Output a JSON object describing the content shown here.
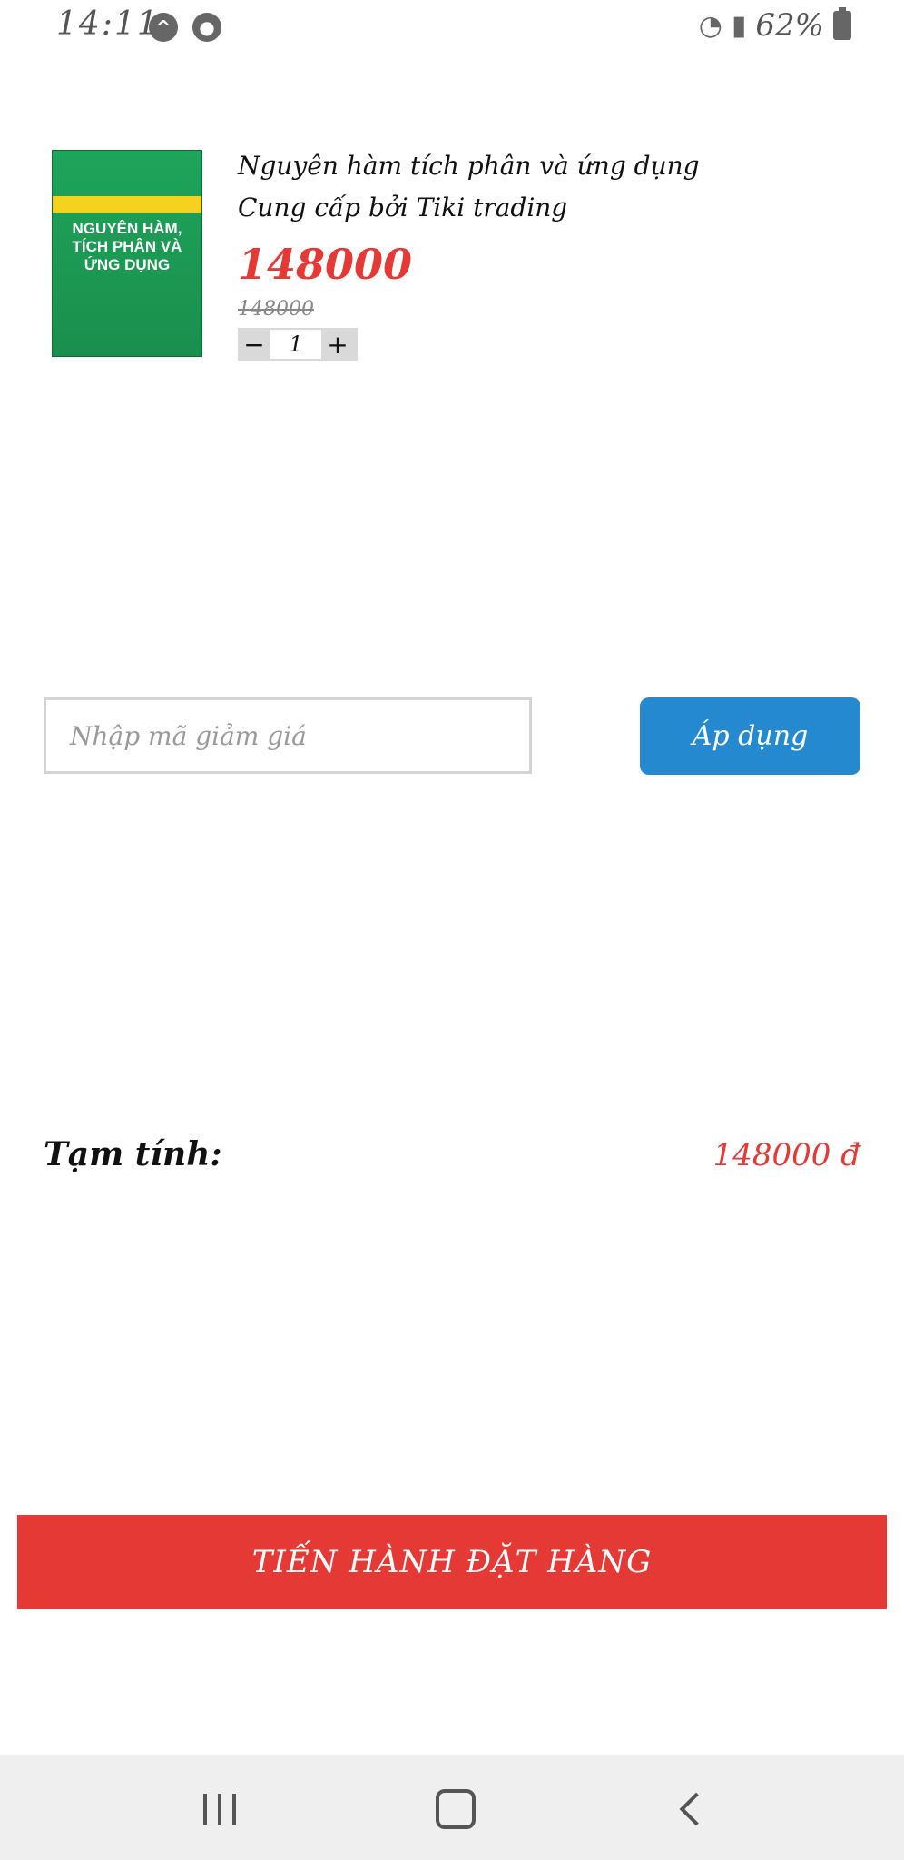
{
  "status_bar": {
    "time": "14:11",
    "battery": "62%",
    "icons": [
      "navigation-icon",
      "account-icon",
      "wifi-icon",
      "signal-icon",
      "battery-icon"
    ]
  },
  "product": {
    "thumb_title": "NGUYÊN HÀM, TÍCH PHÂN VÀ ỨNG DỤNG",
    "title": "Nguyên hàm tích phân và ứng dụng",
    "seller": "Cung cấp bởi Tiki trading",
    "price": "148000",
    "old_price": "148000",
    "quantity": "1",
    "qty_minus": "−",
    "qty_plus": "+"
  },
  "coupon": {
    "placeholder": "Nhập mã giảm giá",
    "apply_label": "Áp dụng"
  },
  "summary": {
    "subtotal_label": "Tạm tính:",
    "subtotal_value": "148000 đ"
  },
  "checkout": {
    "label": "TIẾN HÀNH ĐẶT HÀNG"
  },
  "colors": {
    "accent_red": "#e53935",
    "apply_blue": "#2489cf"
  }
}
